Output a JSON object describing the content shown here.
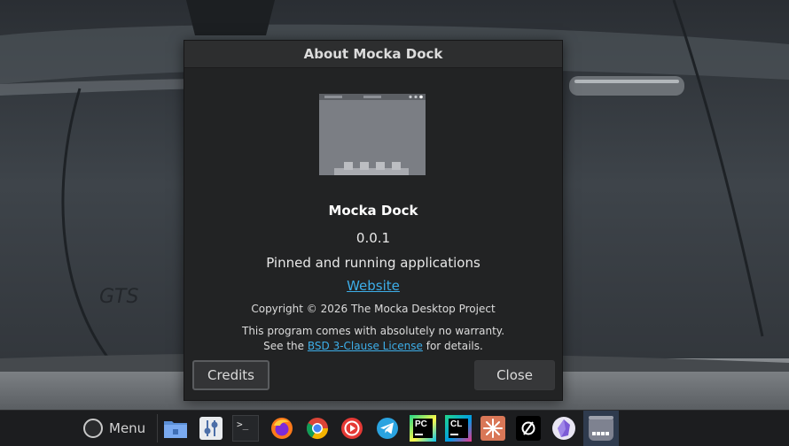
{
  "dialog": {
    "title": "About Mocka Dock",
    "app_name": "Mocka Dock",
    "version": "0.0.1",
    "description": "Pinned and running applications",
    "website_label": "Website",
    "copyright": "Copyright © 2026 The Mocka Desktop Project",
    "warranty_line": "This program comes with absolutely no warranty.",
    "license_prefix": "See the ",
    "license_link": "BSD 3-Clause License",
    "license_suffix": " for details.",
    "credits_label": "Credits",
    "close_label": "Close"
  },
  "taskbar": {
    "menu_label": "Menu",
    "apps": [
      {
        "name": "files",
        "icon": "folder-icon"
      },
      {
        "name": "settings",
        "icon": "sliders-icon"
      },
      {
        "name": "terminal",
        "icon": "terminal-icon",
        "glyph": ">_"
      },
      {
        "name": "firefox",
        "icon": "firefox-icon"
      },
      {
        "name": "chrome",
        "icon": "chrome-icon"
      },
      {
        "name": "music",
        "icon": "music-player-icon"
      },
      {
        "name": "telegram",
        "icon": "telegram-icon"
      },
      {
        "name": "pycharm",
        "icon": "pycharm-icon",
        "glyph": "PC"
      },
      {
        "name": "clion",
        "icon": "clion-icon",
        "glyph": "CL"
      },
      {
        "name": "claude",
        "icon": "claude-icon"
      },
      {
        "name": "app-black",
        "icon": "circle-slash-icon"
      },
      {
        "name": "obsidian",
        "icon": "obsidian-icon"
      },
      {
        "name": "mocka-dock",
        "icon": "dock-icon"
      }
    ]
  },
  "colors": {
    "accent_link": "#3daee9",
    "dialog_bg": "#222324",
    "taskbar_bg": "#1c1d1f"
  }
}
